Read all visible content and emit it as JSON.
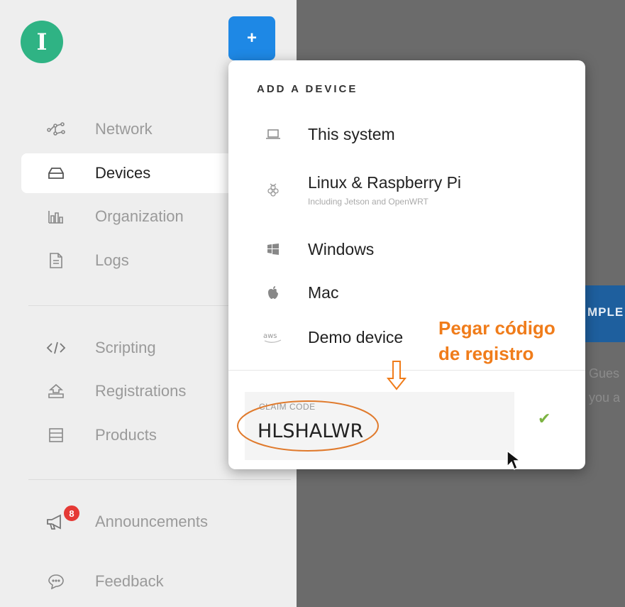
{
  "sidebar": {
    "avatar_letter": "I",
    "add_button_label": "+",
    "items": [
      {
        "label": "Network",
        "icon": "network-icon"
      },
      {
        "label": "Devices",
        "icon": "devices-icon",
        "active": true
      },
      {
        "label": "Organization",
        "icon": "organization-icon"
      },
      {
        "label": "Logs",
        "icon": "logs-icon"
      },
      {
        "label": "Scripting",
        "icon": "code-icon"
      },
      {
        "label": "Registrations",
        "icon": "registrations-icon"
      },
      {
        "label": "Products",
        "icon": "products-icon"
      },
      {
        "label": "Announcements",
        "icon": "megaphone-icon",
        "badge": "8"
      },
      {
        "label": "Feedback",
        "icon": "feedback-icon"
      }
    ]
  },
  "add_device_panel": {
    "title": "ADD A DEVICE",
    "options": [
      {
        "label": "This system",
        "icon": "laptop-icon"
      },
      {
        "label": "Linux & Raspberry Pi",
        "sublabel": "Including Jetson and OpenWRT",
        "icon": "raspberry-pi-icon"
      },
      {
        "label": "Windows",
        "icon": "windows-icon"
      },
      {
        "label": "Mac",
        "icon": "apple-icon"
      },
      {
        "label": "Demo device",
        "icon": "aws-icon"
      }
    ],
    "claim_code": {
      "label": "CLAIM CODE",
      "value": "HLSHALWR"
    }
  },
  "annotation": {
    "line1": "Pegar código",
    "line2": "de registro"
  },
  "background": {
    "banner_text": "MPLE",
    "text_line1": "Gues",
    "text_line2": "you a"
  },
  "colors": {
    "accent": "#1e88e5",
    "avatar": "#2fb384",
    "badge": "#e53935",
    "annotation": "#f07c1a",
    "check": "#7cb342"
  }
}
